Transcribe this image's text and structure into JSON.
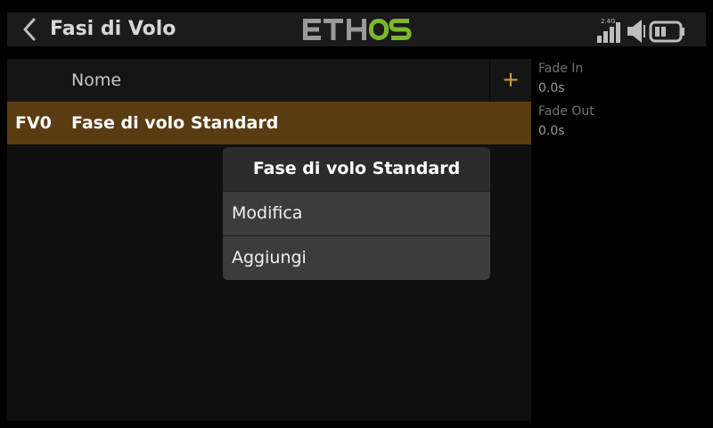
{
  "header": {
    "title": "Fasi di Volo",
    "logo_text": "ETHOS",
    "status": {
      "band_label": "2.4G",
      "signal_bars": 4,
      "icons": [
        "signal-icon",
        "volume-icon",
        "battery-icon"
      ]
    }
  },
  "list": {
    "column_name": "Nome",
    "add_icon": "+",
    "rows": [
      {
        "id": "FV0",
        "name": "Fase di volo Standard",
        "selected": true
      }
    ]
  },
  "side": {
    "fade_in_label": "Fade In",
    "fade_in_value": "0.0s",
    "fade_out_label": "Fade Out",
    "fade_out_value": "0.0s"
  },
  "popup": {
    "title": "Fase di volo Standard",
    "items": [
      "Modifica",
      "Aggiungi"
    ]
  },
  "colors": {
    "accent": "#d4a12a",
    "logo_green": "#7cb82f",
    "selected_row": "#5a3c12"
  }
}
